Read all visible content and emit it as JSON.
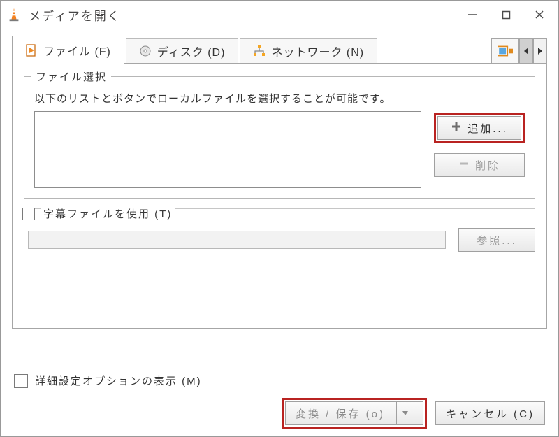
{
  "window": {
    "title": "メディアを開く"
  },
  "tabs": {
    "file": {
      "label": "ファイル (F)"
    },
    "disc": {
      "label": "ディスク (D)"
    },
    "network": {
      "label": "ネットワーク (N)"
    }
  },
  "file_group": {
    "legend": "ファイル選択",
    "help": "以下のリストとボタンでローカルファイルを選択することが可能です。",
    "add_label": "追加...",
    "remove_label": "削除"
  },
  "subtitle": {
    "checkbox_label": "字幕ファイルを使用 (T)",
    "browse_label": "参照..."
  },
  "advanced": {
    "checkbox_label": "詳細設定オプションの表示 (M)"
  },
  "footer": {
    "convert_label": "変換 / 保存 (o)",
    "cancel_label": "キャンセル (C)"
  }
}
